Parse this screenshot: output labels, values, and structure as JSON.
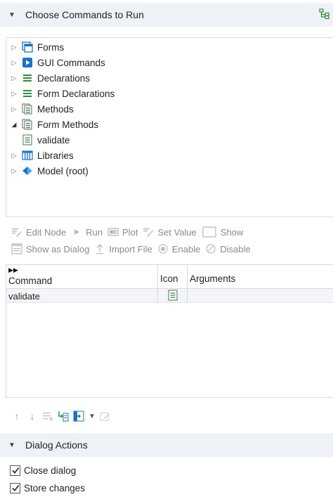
{
  "commands_section": {
    "title": "Choose Commands to Run",
    "tree": [
      {
        "label": "Forms",
        "expanded": false,
        "icon": "forms-icon"
      },
      {
        "label": "GUI Commands",
        "expanded": false,
        "icon": "gui-commands-icon"
      },
      {
        "label": "Declarations",
        "expanded": false,
        "icon": "declarations-icon"
      },
      {
        "label": "Form Declarations",
        "expanded": false,
        "icon": "form-declarations-icon"
      },
      {
        "label": "Methods",
        "expanded": false,
        "icon": "methods-icon"
      },
      {
        "label": "Form Methods",
        "expanded": true,
        "icon": "form-methods-icon"
      },
      {
        "label": "validate",
        "child": true,
        "icon": "method-icon"
      },
      {
        "label": "Libraries",
        "expanded": false,
        "icon": "libraries-icon"
      },
      {
        "label": "Model (root)",
        "expanded": false,
        "icon": "model-icon"
      }
    ]
  },
  "toolbar": {
    "edit_node": "Edit Node",
    "run": "Run",
    "plot": "Plot",
    "set_value": "Set Value",
    "show": "Show",
    "show_as_dialog": "Show as Dialog",
    "import_file": "Import File",
    "enable": "Enable",
    "disable": "Disable"
  },
  "table": {
    "columns": [
      "Command",
      "Icon",
      "Arguments"
    ],
    "rows": [
      {
        "command": "validate",
        "icon": "method-icon",
        "arguments": ""
      }
    ]
  },
  "dialog_actions": {
    "title": "Dialog Actions",
    "checks": [
      {
        "label": "Close dialog",
        "checked": true
      },
      {
        "label": "Store changes",
        "checked": true
      }
    ]
  },
  "colors": {
    "header_bg": "#eef2f7",
    "accent_blue": "#1a73c9",
    "green": "#2e8b3a"
  }
}
